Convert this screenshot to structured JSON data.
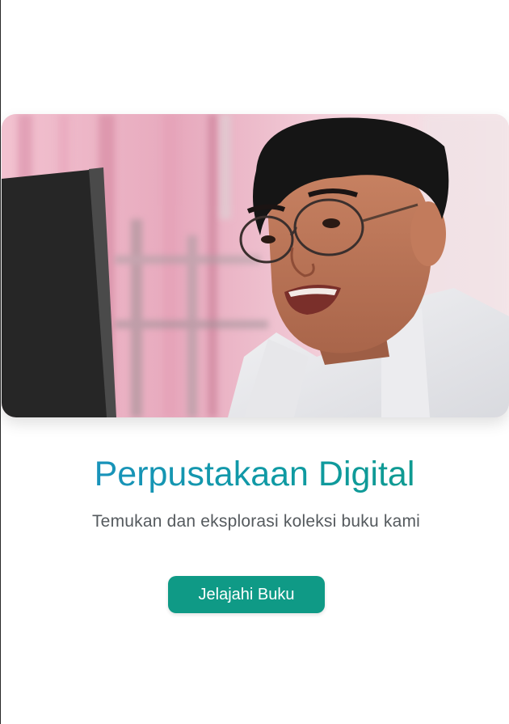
{
  "hero": {
    "image_alt": "Student wearing glasses smiling at a computer screen"
  },
  "title": "Perpustakaan Digital",
  "subtitle": "Temukan dan eksplorasi koleksi buku kami",
  "cta": {
    "label": "Jelajahi Buku"
  },
  "colors": {
    "accent": "#0f9a86",
    "title_gradient_start": "#1e8fc7",
    "title_gradient_end": "#0f9a84",
    "subtitle": "#555a5e"
  }
}
